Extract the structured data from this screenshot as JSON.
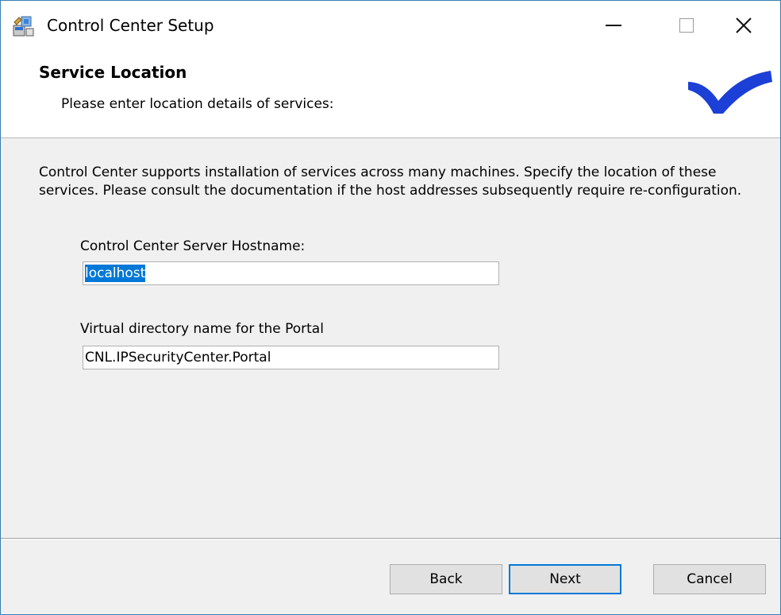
{
  "window": {
    "title": "Control Center Setup",
    "title_icon": "installer-icon",
    "controls": {
      "minimize": "minimize-icon",
      "maximize": "maximize-icon",
      "close": "×"
    }
  },
  "banner": {
    "title": "Service Location",
    "subtitle": "Please enter location details of services:",
    "logo": "checkmark-logo",
    "logo_color": "#1c3fd6"
  },
  "main": {
    "description": "Control Center supports installation of services across many machines. Specify the location of these services. Please consult the documentation if the host addresses subsequently require re-configuration.",
    "fields": {
      "hostname": {
        "label": "Control Center Server Hostname:",
        "value": "localhost"
      },
      "virtual_dir": {
        "label": "Virtual directory name for the Portal",
        "value": "CNL.IPSecurityCenter.Portal"
      }
    }
  },
  "footer": {
    "back_label": "Back",
    "next_label": "Next",
    "cancel_label": "Cancel",
    "focus_color": "#0078d7"
  }
}
